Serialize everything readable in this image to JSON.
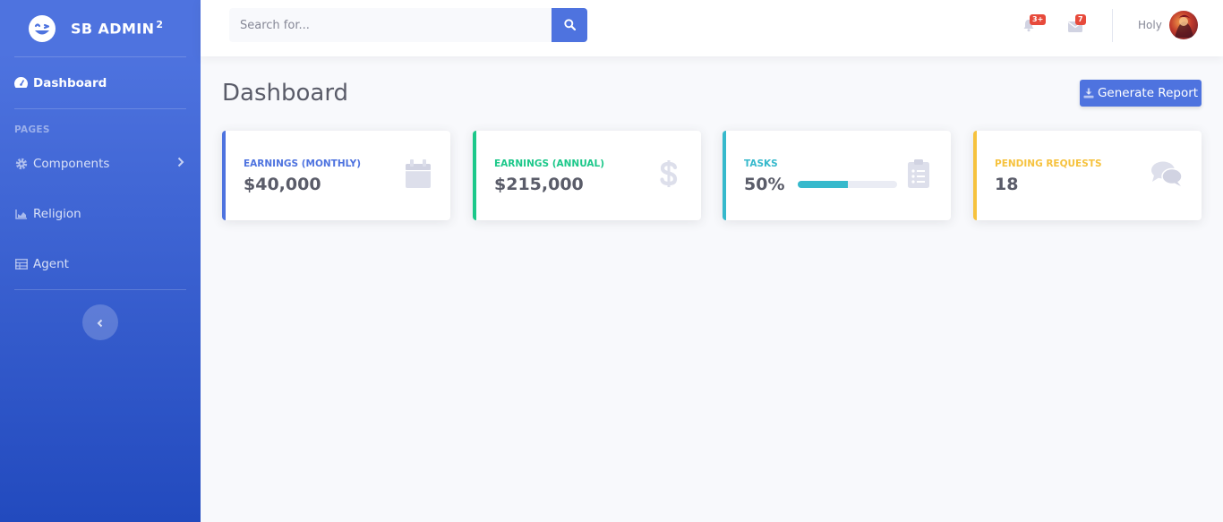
{
  "brand": {
    "name": "SB ADMIN",
    "sup": "2"
  },
  "sidebar": {
    "active_item": {
      "label": "Dashboard",
      "icon": "tachometer-icon"
    },
    "heading": "PAGES",
    "items": [
      {
        "label": "Components",
        "icon": "gear-icon",
        "has_chevron": true
      },
      {
        "label": "Religion",
        "icon": "area-chart-icon"
      },
      {
        "label": "Agent",
        "icon": "table-icon"
      }
    ]
  },
  "topbar": {
    "search_placeholder": "Search for...",
    "alerts_badge": "3+",
    "messages_badge": "7",
    "user_name": "Holy"
  },
  "page": {
    "title": "Dashboard",
    "report_button": "Generate Report"
  },
  "cards": [
    {
      "label": "Earnings (Monthly)",
      "value": "$40,000",
      "color": "#4e73df",
      "icon": "calendar-icon"
    },
    {
      "label": "Earnings (Annual)",
      "value": "$215,000",
      "color": "#1cc88a",
      "icon": "dollar-icon"
    },
    {
      "label": "Tasks",
      "value": "50%",
      "color": "#36b9cc",
      "icon": "clipboard-list-icon",
      "progress": 0.5
    },
    {
      "label": "Pending Requests",
      "value": "18",
      "color": "#f6c23e",
      "icon": "comments-icon"
    }
  ],
  "colors": {
    "primary": "#4e73df",
    "success": "#1cc88a",
    "info": "#36b9cc",
    "warning": "#f6c23e",
    "danger": "#e74a3b"
  }
}
